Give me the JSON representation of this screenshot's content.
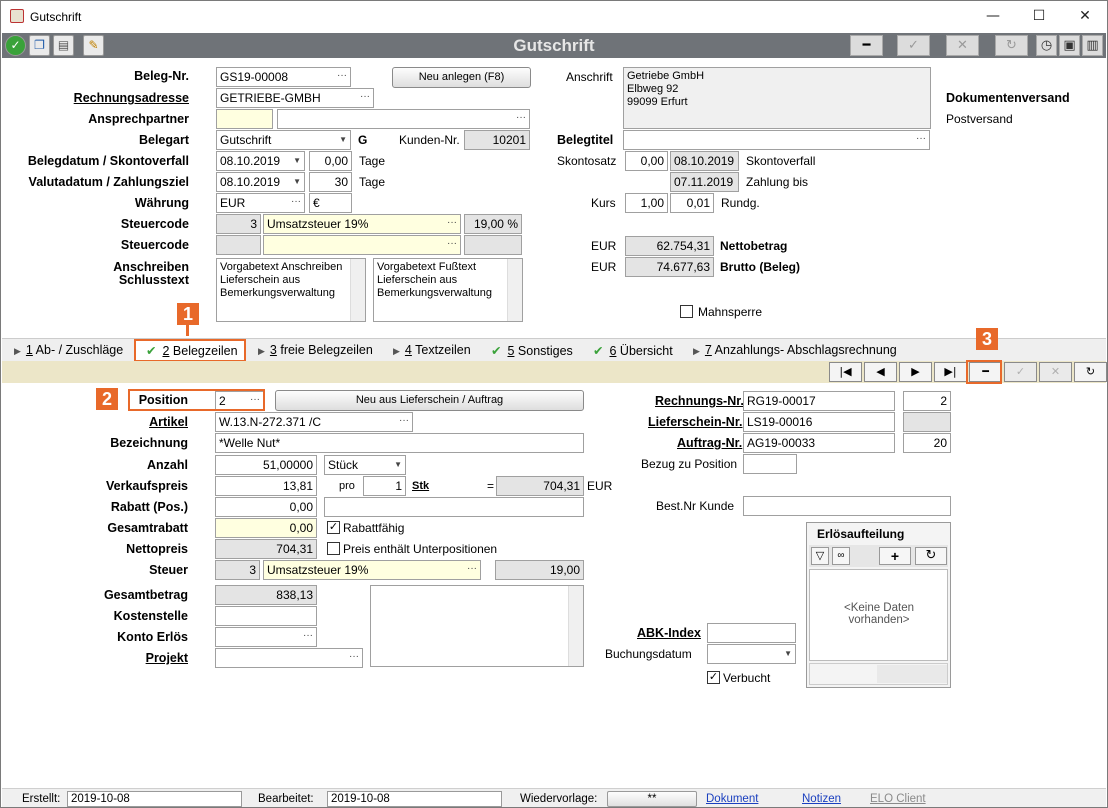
{
  "window": {
    "title": "Gutschrift",
    "min": "—",
    "max": "☐",
    "close": "✕"
  },
  "toolbar": {
    "title": "Gutschrift"
  },
  "header": {
    "beleg_nr_label": "Beleg-Nr.",
    "beleg_nr": "GS19-00008",
    "neu_anlegen": "Neu anlegen (F8)",
    "rechnungsadresse_label": "Rechnungsadresse",
    "rechnungsadresse": "GETRIEBE-GMBH",
    "ansprechpartner_label": "Ansprechpartner",
    "belegart_label": "Belegart",
    "belegart": "Gutschrift",
    "belegart_code": "G",
    "kunden_nr_label": "Kunden-Nr.",
    "kunden_nr": "10201",
    "belegdatum_label": "Belegdatum / Skontoverfall",
    "belegdatum": "08.10.2019",
    "skonto_tage": "0,00",
    "tage1": "Tage",
    "valutadatum_label": "Valutadatum / Zahlungsziel",
    "valutadatum": "08.10.2019",
    "zahlungsziel": "30",
    "tage2": "Tage",
    "waehrung_label": "Währung",
    "waehrung": "EUR",
    "waehrung_symbol": "€",
    "steuercode_label": "Steuercode",
    "steuercode_nr": "3",
    "steuercode_text": "Umsatzsteuer 19%",
    "steuercode_pct": "19,00 %",
    "steuercode2_label": "Steuercode",
    "anschreiben_label": "Anschreiben",
    "schlusstext_label": "Schlusstext",
    "anschreiben_text": "Vorgabetext Anschreiben Lieferschein aus Bemerkungsverwaltung",
    "fusstext": "Vorgabetext Fußtext Lieferschein aus Bemerkungsverwaltung",
    "anschrift_label": "Anschrift",
    "anschrift_line1": "Getriebe GmbH",
    "anschrift_line2": "Elbweg 92",
    "anschrift_line3": "99099 Erfurt",
    "dokumentenversand_label": "Dokumentenversand",
    "dokumentenversand": "Postversand",
    "belegtitel_label": "Belegtitel",
    "skontosatz_label": "Skontosatz",
    "skontosatz": "0,00",
    "skontoverfall_datum": "08.10.2019",
    "skontoverfall_label": "Skontoverfall",
    "zahlung_bis_datum": "07.11.2019",
    "zahlung_bis_label": "Zahlung bis",
    "kurs_label": "Kurs",
    "kurs": "1,00",
    "rundg": "0,01",
    "rundg_label": "Rundg.",
    "eur1": "EUR",
    "nettobetrag": "62.754,31",
    "nettobetrag_label": "Nettobetrag",
    "eur2": "EUR",
    "brutto": "74.677,63",
    "brutto_label": "Brutto (Beleg)",
    "mahnsperre_label": "Mahnsperre"
  },
  "tabs": [
    {
      "num": "1",
      "label": " Ab- / Zuschläge",
      "check": false
    },
    {
      "num": "2",
      "label": " Belegzeilen",
      "check": true
    },
    {
      "num": "3",
      "label": " freie Belegzeilen",
      "check": false
    },
    {
      "num": "4",
      "label": " Textzeilen",
      "check": false
    },
    {
      "num": "5",
      "label": " Sonstiges",
      "check": true
    },
    {
      "num": "6",
      "label": " Übersicht",
      "check": true
    },
    {
      "num": "7",
      "label": " Anzahlungs- Abschlagsrechnung",
      "check": false
    }
  ],
  "callouts": {
    "c1": "1",
    "c2": "2",
    "c3": "3"
  },
  "pos": {
    "position_label": "Position",
    "position": "2",
    "neu_aus": "Neu aus Lieferschein / Auftrag",
    "artikel_label": "Artikel",
    "artikel": "W.13.N-272.371 /C",
    "bezeichnung_label": "Bezeichnung",
    "bezeichnung": "*Welle Nut*",
    "anzahl_label": "Anzahl",
    "anzahl": "51,00000",
    "einheit": "Stück",
    "verkaufspreis_label": "Verkaufspreis",
    "verkaufspreis": "13,81",
    "pro": "pro",
    "pro_menge": "1",
    "stk": "Stk",
    "eq": "=",
    "summe": "704,31",
    "summe_eur": "EUR",
    "rabatt_label": "Rabatt (Pos.)",
    "rabatt": "0,00",
    "gesamtrabatt_label": "Gesamtrabatt",
    "gesamtrabatt": "0,00",
    "rabattfaehig": "Rabattfähig",
    "nettopreis_label": "Nettopreis",
    "nettopreis": "704,31",
    "preis_unterpos": "Preis enthält Unterpositionen",
    "steuer_label": "Steuer",
    "steuer_nr": "3",
    "steuer_text": "Umsatzsteuer 19%",
    "steuer_betrag": "19,00",
    "gesamtbetrag_label": "Gesamtbetrag",
    "gesamtbetrag": "838,13",
    "kostenstelle_label": "Kostenstelle",
    "konto_label": "Konto Erlös",
    "projekt_label": "Projekt",
    "rechnungs_nr_label": "Rechnungs-Nr.",
    "rechnungs_nr": "RG19-00017",
    "rechnungs_pos": "2",
    "lieferschein_nr_label": "Lieferschein-Nr.",
    "lieferschein_nr": "LS19-00016",
    "auftrag_nr_label": "Auftrag-Nr.",
    "auftrag_nr": "AG19-00033",
    "auftrag_pos": "20",
    "bezug_label": "Bezug zu Position",
    "bestnr_label": "Best.Nr Kunde",
    "abk_label": "ABK-Index",
    "buchungsdatum_label": "Buchungsdatum",
    "verbucht_label": "Verbucht",
    "erloes_title": "Erlösaufteilung",
    "erloes_empty": "<Keine Daten vorhanden>"
  },
  "status": {
    "erstellt_label": "Erstellt:",
    "erstellt": "2019-10-08",
    "bearbeitet_label": "Bearbeitet:",
    "bearbeitet": "2019-10-08",
    "wiedervorlage_label": "Wiedervorlage:",
    "wiedervorlage": "**",
    "dokument": "Dokument",
    "notizen": "Notizen",
    "elo": "ELO Client"
  }
}
